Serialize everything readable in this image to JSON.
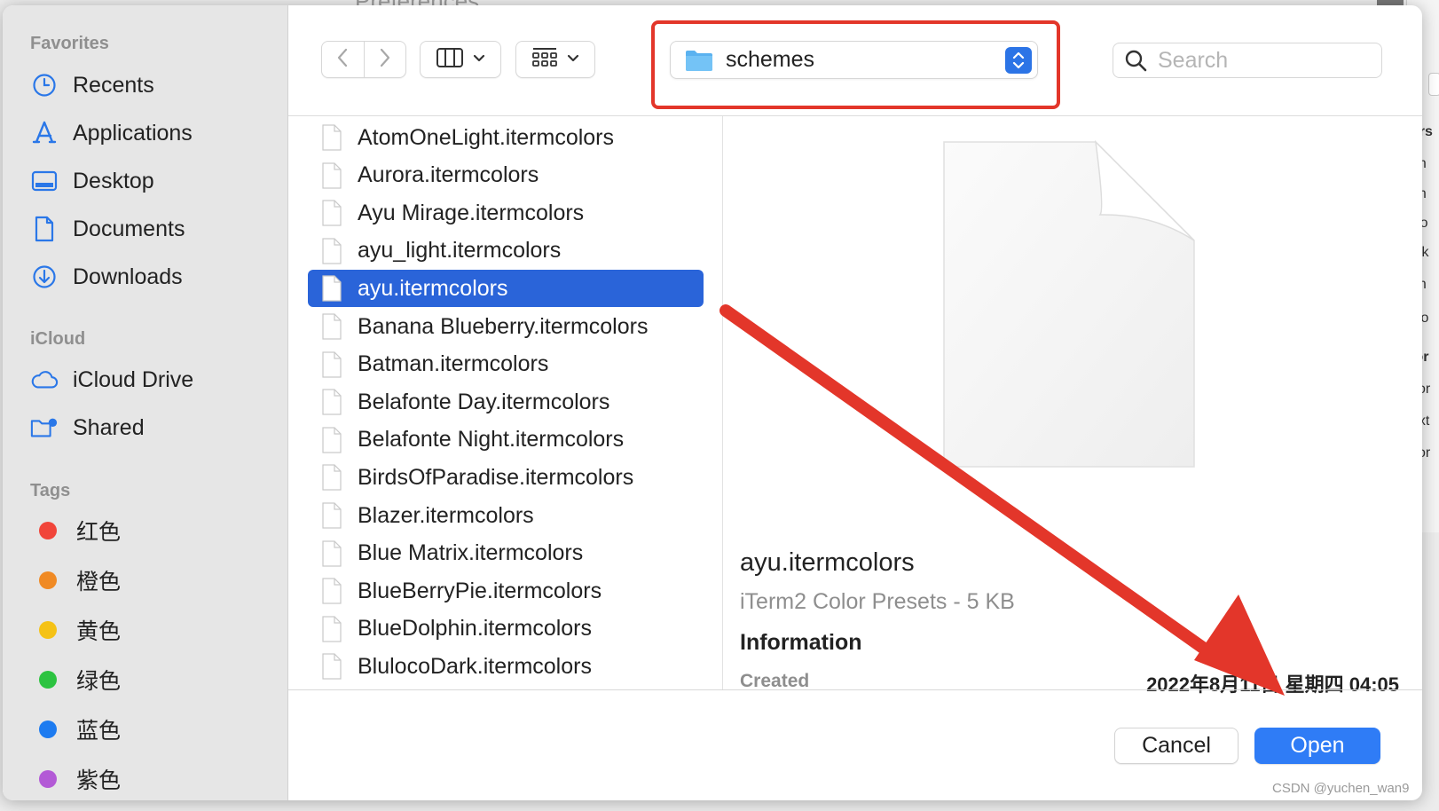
{
  "background_window": {
    "title": "Preferences",
    "side_fragments": [
      "ors",
      "un",
      "un",
      "Bo",
      "ink",
      "en",
      "Co",
      "lor",
      "sor",
      "ext",
      "sor"
    ]
  },
  "sidebar": {
    "favorites_title": "Favorites",
    "favorites": [
      {
        "label": "Recents",
        "icon": "clock-icon"
      },
      {
        "label": "Applications",
        "icon": "applications-icon"
      },
      {
        "label": "Desktop",
        "icon": "desktop-icon"
      },
      {
        "label": "Documents",
        "icon": "document-icon"
      },
      {
        "label": "Downloads",
        "icon": "download-icon"
      }
    ],
    "icloud_title": "iCloud",
    "icloud": [
      {
        "label": "iCloud Drive",
        "icon": "cloud-icon"
      },
      {
        "label": "Shared",
        "icon": "shared-folder-icon"
      }
    ],
    "tags_title": "Tags",
    "tags": [
      {
        "label": "红色",
        "color": "#f1453a"
      },
      {
        "label": "橙色",
        "color": "#f08a24"
      },
      {
        "label": "黄色",
        "color": "#f5c216"
      },
      {
        "label": "绿色",
        "color": "#2cc340"
      },
      {
        "label": "蓝色",
        "color": "#1d7bf0"
      },
      {
        "label": "紫色",
        "color": "#b35ad6"
      }
    ]
  },
  "toolbar": {
    "back_icon": "chevron-left-icon",
    "forward_icon": "chevron-right-icon",
    "column_view_icon": "columns-icon",
    "group_view_icon": "grid-icon",
    "location": "schemes",
    "search_placeholder": "Search",
    "accent_color": "#2c74e6",
    "highlight_color": "#e3362a"
  },
  "files": [
    {
      "name": "AtomOneLight.itermcolors",
      "selected": false
    },
    {
      "name": "Aurora.itermcolors",
      "selected": false
    },
    {
      "name": "Ayu Mirage.itermcolors",
      "selected": false
    },
    {
      "name": "ayu_light.itermcolors",
      "selected": false
    },
    {
      "name": "ayu.itermcolors",
      "selected": true
    },
    {
      "name": "Banana Blueberry.itermcolors",
      "selected": false
    },
    {
      "name": "Batman.itermcolors",
      "selected": false
    },
    {
      "name": "Belafonte Day.itermcolors",
      "selected": false
    },
    {
      "name": "Belafonte Night.itermcolors",
      "selected": false
    },
    {
      "name": "BirdsOfParadise.itermcolors",
      "selected": false
    },
    {
      "name": "Blazer.itermcolors",
      "selected": false
    },
    {
      "name": "Blue Matrix.itermcolors",
      "selected": false
    },
    {
      "name": "BlueBerryPie.itermcolors",
      "selected": false
    },
    {
      "name": "BlueDolphin.itermcolors",
      "selected": false
    },
    {
      "name": "BlulocoDark.itermcolors",
      "selected": false
    }
  ],
  "preview": {
    "name": "ayu.itermcolors",
    "kind": "iTerm2 Color Presets - 5 KB",
    "info_title": "Information",
    "created_label": "Created",
    "created_value": "2022年8月11日 星期四 04:05"
  },
  "buttons": {
    "cancel": "Cancel",
    "open": "Open"
  },
  "watermark": "CSDN @yuchen_wan9"
}
